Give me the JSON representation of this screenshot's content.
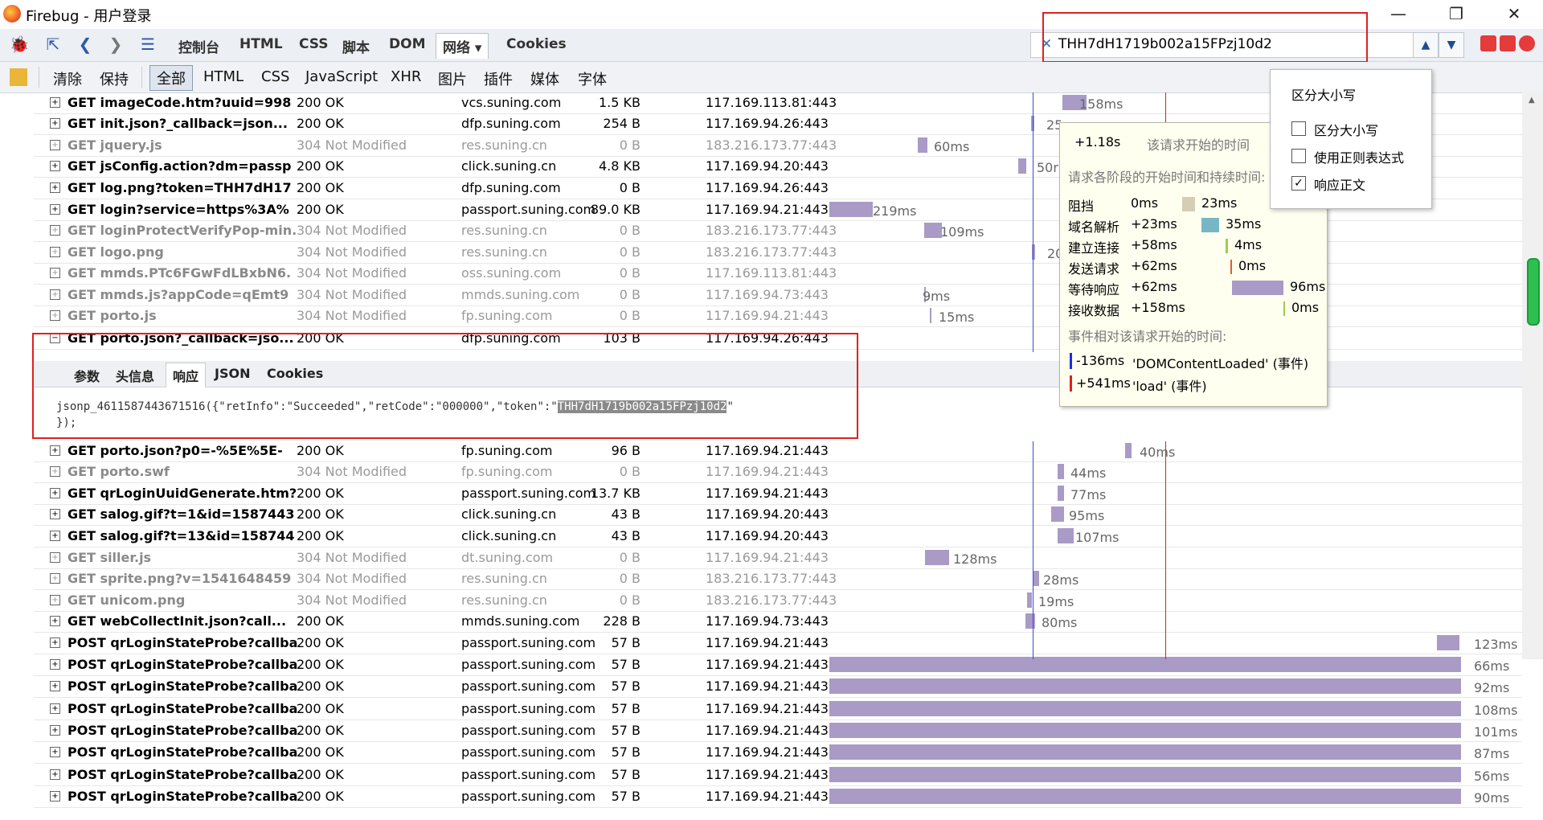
{
  "window": {
    "title": "Firebug - 用户登录"
  },
  "toolbar": {
    "tabs": [
      "控制台",
      "HTML",
      "CSS",
      "脚本",
      "DOM",
      "网络 ▾",
      "Cookies"
    ],
    "active_tab": "网络 ▾"
  },
  "search": {
    "query": "THH7dH1719b002a15FPzj10d2"
  },
  "filter": {
    "actions": [
      "清除",
      "保持"
    ],
    "types": [
      "全部",
      "HTML",
      "CSS",
      "JavaScript",
      "XHR",
      "图片",
      "插件",
      "媒体",
      "字体"
    ]
  },
  "requests": [
    {
      "url": "GET imageCode.htm?uuid=998",
      "status": "200 OK",
      "domain": "vcs.suning.com",
      "size": "1.5 KB",
      "ip": "117.169.113.81:443",
      "time": "158ms",
      "dim": false
    },
    {
      "url": "GET init.json?_callback=json...",
      "status": "200 OK",
      "domain": "dfp.suning.com",
      "size": "254 B",
      "ip": "117.169.94.26:443",
      "time": "25",
      "dim": false
    },
    {
      "url": "GET jquery.js",
      "status": "304 Not Modified",
      "domain": "res.suning.cn",
      "size": "0 B",
      "ip": "183.216.173.77:443",
      "time": "60ms",
      "dim": true
    },
    {
      "url": "GET jsConfig.action?dm=passp",
      "status": "200 OK",
      "domain": "click.suning.cn",
      "size": "4.8 KB",
      "ip": "117.169.94.20:443",
      "time": "50r",
      "dim": false
    },
    {
      "url": "GET log.png?token=THH7dH17",
      "status": "200 OK",
      "domain": "dfp.suning.com",
      "size": "0 B",
      "ip": "117.169.94.26:443",
      "time": "",
      "dim": false
    },
    {
      "url": "GET login?service=https%3A%",
      "status": "200 OK",
      "domain": "passport.suning.com",
      "size": "89.0 KB",
      "ip": "117.169.94.21:443",
      "time": "219ms",
      "dim": false
    },
    {
      "url": "GET loginProtectVerifyPop-min.",
      "status": "304 Not Modified",
      "domain": "res.suning.cn",
      "size": "0 B",
      "ip": "183.216.173.77:443",
      "time": "109ms",
      "dim": true
    },
    {
      "url": "GET logo.png",
      "status": "304 Not Modified",
      "domain": "res.suning.cn",
      "size": "0 B",
      "ip": "183.216.173.77:443",
      "time": "20",
      "dim": true
    },
    {
      "url": "GET mmds.PTc6FGwFdLBxbN6.",
      "status": "304 Not Modified",
      "domain": "oss.suning.com",
      "size": "0 B",
      "ip": "117.169.113.81:443",
      "time": "",
      "dim": true
    },
    {
      "url": "GET mmds.js?appCode=qEmt9",
      "status": "304 Not Modified",
      "domain": "mmds.suning.com",
      "size": "0 B",
      "ip": "117.169.94.73:443",
      "time": "9ms",
      "dim": true
    },
    {
      "url": "GET porto.js",
      "status": "304 Not Modified",
      "domain": "fp.suning.com",
      "size": "0 B",
      "ip": "117.169.94.21:443",
      "time": "15ms",
      "dim": true
    },
    {
      "url": "GET porto.json?_callback=jso...",
      "status": "200 OK",
      "domain": "dfp.suning.com",
      "size": "103 B",
      "ip": "117.169.94.26:443",
      "time": "",
      "dim": false
    },
    {
      "url": "GET porto.json?p0=-%5E%5E-",
      "status": "200 OK",
      "domain": "fp.suning.com",
      "size": "96 B",
      "ip": "117.169.94.21:443",
      "time": "40ms",
      "dim": false
    },
    {
      "url": "GET porto.swf",
      "status": "304 Not Modified",
      "domain": "fp.suning.com",
      "size": "0 B",
      "ip": "117.169.94.21:443",
      "time": "44ms",
      "dim": true
    },
    {
      "url": "GET qrLoginUuidGenerate.htm?",
      "status": "200 OK",
      "domain": "passport.suning.com",
      "size": "13.7 KB",
      "ip": "117.169.94.21:443",
      "time": "77ms",
      "dim": false
    },
    {
      "url": "GET salog.gif?t=1&id=1587443",
      "status": "200 OK",
      "domain": "click.suning.cn",
      "size": "43 B",
      "ip": "117.169.94.20:443",
      "time": "95ms",
      "dim": false
    },
    {
      "url": "GET salog.gif?t=13&id=158744",
      "status": "200 OK",
      "domain": "click.suning.cn",
      "size": "43 B",
      "ip": "117.169.94.20:443",
      "time": "107ms",
      "dim": false
    },
    {
      "url": "GET siller.js",
      "status": "304 Not Modified",
      "domain": "dt.suning.com",
      "size": "0 B",
      "ip": "117.169.94.21:443",
      "time": "128ms",
      "dim": true
    },
    {
      "url": "GET sprite.png?v=1541648459",
      "status": "304 Not Modified",
      "domain": "res.suning.cn",
      "size": "0 B",
      "ip": "183.216.173.77:443",
      "time": "28ms",
      "dim": true
    },
    {
      "url": "GET unicom.png",
      "status": "304 Not Modified",
      "domain": "res.suning.cn",
      "size": "0 B",
      "ip": "183.216.173.77:443",
      "time": "19ms",
      "dim": true
    },
    {
      "url": "GET webCollectInit.json?call...",
      "status": "200 OK",
      "domain": "mmds.suning.com",
      "size": "228 B",
      "ip": "117.169.94.73:443",
      "time": "80ms",
      "dim": false
    },
    {
      "url": "POST qrLoginStateProbe?callba",
      "status": "200 OK",
      "domain": "passport.suning.com",
      "size": "57 B",
      "ip": "117.169.94.21:443",
      "time": "123ms",
      "dim": false
    },
    {
      "url": "POST qrLoginStateProbe?callba",
      "status": "200 OK",
      "domain": "passport.suning.com",
      "size": "57 B",
      "ip": "117.169.94.21:443",
      "time": "66ms",
      "dim": false
    },
    {
      "url": "POST qrLoginStateProbe?callba",
      "status": "200 OK",
      "domain": "passport.suning.com",
      "size": "57 B",
      "ip": "117.169.94.21:443",
      "time": "92ms",
      "dim": false
    },
    {
      "url": "POST qrLoginStateProbe?callba",
      "status": "200 OK",
      "domain": "passport.suning.com",
      "size": "57 B",
      "ip": "117.169.94.21:443",
      "time": "108ms",
      "dim": false
    },
    {
      "url": "POST qrLoginStateProbe?callba",
      "status": "200 OK",
      "domain": "passport.suning.com",
      "size": "57 B",
      "ip": "117.169.94.21:443",
      "time": "101ms",
      "dim": false
    },
    {
      "url": "POST qrLoginStateProbe?callba",
      "status": "200 OK",
      "domain": "passport.suning.com",
      "size": "57 B",
      "ip": "117.169.94.21:443",
      "time": "87ms",
      "dim": false
    },
    {
      "url": "POST qrLoginStateProbe?callba",
      "status": "200 OK",
      "domain": "passport.suning.com",
      "size": "57 B",
      "ip": "117.169.94.21:443",
      "time": "56ms",
      "dim": false
    },
    {
      "url": "POST qrLoginStateProbe?callba",
      "status": "200 OK",
      "domain": "passport.suning.com",
      "size": "57 B",
      "ip": "117.169.94.21:443",
      "time": "90ms",
      "dim": false
    }
  ],
  "detail": {
    "tabs": [
      "参数",
      "头信息",
      "响应",
      "JSON",
      "Cookies"
    ],
    "active_tab": "响应",
    "response_prefix": "jsonp_4611587443671516({\"retInfo\":\"Succeeded\",\"retCode\":\"000000\",\"token\":\"",
    "response_token": "THH7dH1719b002a15FPzj10d2",
    "response_suffix": "\"",
    "response_line2": "});"
  },
  "tooltip": {
    "start_offset": "+1.18s",
    "start_label": "该请求开始的时间",
    "phases_title": "请求各阶段的开始时间和持续时间:",
    "phases": [
      {
        "name": "阻挡",
        "start": "0ms",
        "duration": "23ms"
      },
      {
        "name": "域名解析",
        "start": "+23ms",
        "duration": "35ms"
      },
      {
        "name": "建立连接",
        "start": "+58ms",
        "duration": "4ms"
      },
      {
        "name": "发送请求",
        "start": "+62ms",
        "duration": "0ms"
      },
      {
        "name": "等待响应",
        "start": "+62ms",
        "duration": "96ms"
      },
      {
        "name": "接收数据",
        "start": "+158ms",
        "duration": "0ms"
      }
    ],
    "events_title": "事件相对该请求开始的时间:",
    "events": [
      {
        "time": "-136ms",
        "name": "'DOMContentLoaded' (事件)",
        "color": "#1a2fd6"
      },
      {
        "time": "+541ms",
        "name": "'load' (事件)",
        "color": "#e02020"
      }
    ]
  },
  "search_menu": {
    "title": "区分大小写",
    "options": [
      {
        "label": "区分大小写",
        "checked": false
      },
      {
        "label": "使用正则表达式",
        "checked": false
      },
      {
        "label": "响应正文",
        "checked": true
      }
    ]
  },
  "colors": {
    "bar": "#a99ac6",
    "dom_line": "#2a3bd6",
    "load_line": "#e02020",
    "highlight": "#e02020"
  }
}
